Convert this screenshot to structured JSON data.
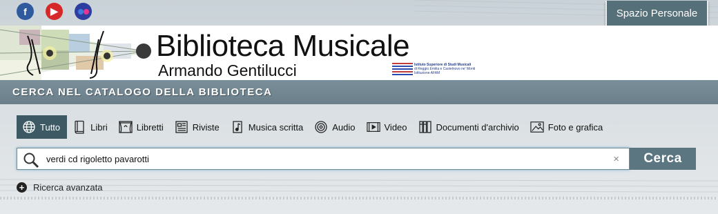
{
  "topbar": {
    "social": [
      {
        "name": "facebook-icon",
        "glyph": "f"
      },
      {
        "name": "youtube-icon",
        "glyph": "▶"
      },
      {
        "name": "flickr-icon",
        "glyph": "●"
      }
    ],
    "personal_area_label": "Spazio Personale"
  },
  "header": {
    "title": "Biblioteca Musicale",
    "subtitle": "Armando Gentilucci",
    "institute": {
      "line1": "Istituto Superiore di Studi Musicali",
      "line2": "di Reggio Emilia e Castelnovo ne' Monti",
      "line3": "Istituzione AFAM"
    }
  },
  "catalog": {
    "title": "CERCA NEL CATALOGO DELLA BIBLIOTECA"
  },
  "tabs": [
    {
      "label": "Tutto",
      "icon": "globe-icon",
      "active": true
    },
    {
      "label": "Libri",
      "icon": "book-icon",
      "active": false
    },
    {
      "label": "Libretti",
      "icon": "theater-icon",
      "active": false
    },
    {
      "label": "Riviste",
      "icon": "newspaper-icon",
      "active": false
    },
    {
      "label": "Musica scritta",
      "icon": "sheet-music-icon",
      "active": false
    },
    {
      "label": "Audio",
      "icon": "disc-icon",
      "active": false
    },
    {
      "label": "Video",
      "icon": "film-icon",
      "active": false
    },
    {
      "label": "Documenti d'archivio",
      "icon": "archive-icon",
      "active": false
    },
    {
      "label": "Foto e grafica",
      "icon": "image-icon",
      "active": false
    }
  ],
  "search": {
    "value": "verdi cd rigoletto pavarotti",
    "clear_glyph": "×",
    "button_label": "Cerca"
  },
  "advanced": {
    "label": "Ricerca avanzata",
    "icon_glyph": "+"
  },
  "colors": {
    "accent": "#3d5a64",
    "button": "#5b7681",
    "banner": "#6f848f"
  }
}
